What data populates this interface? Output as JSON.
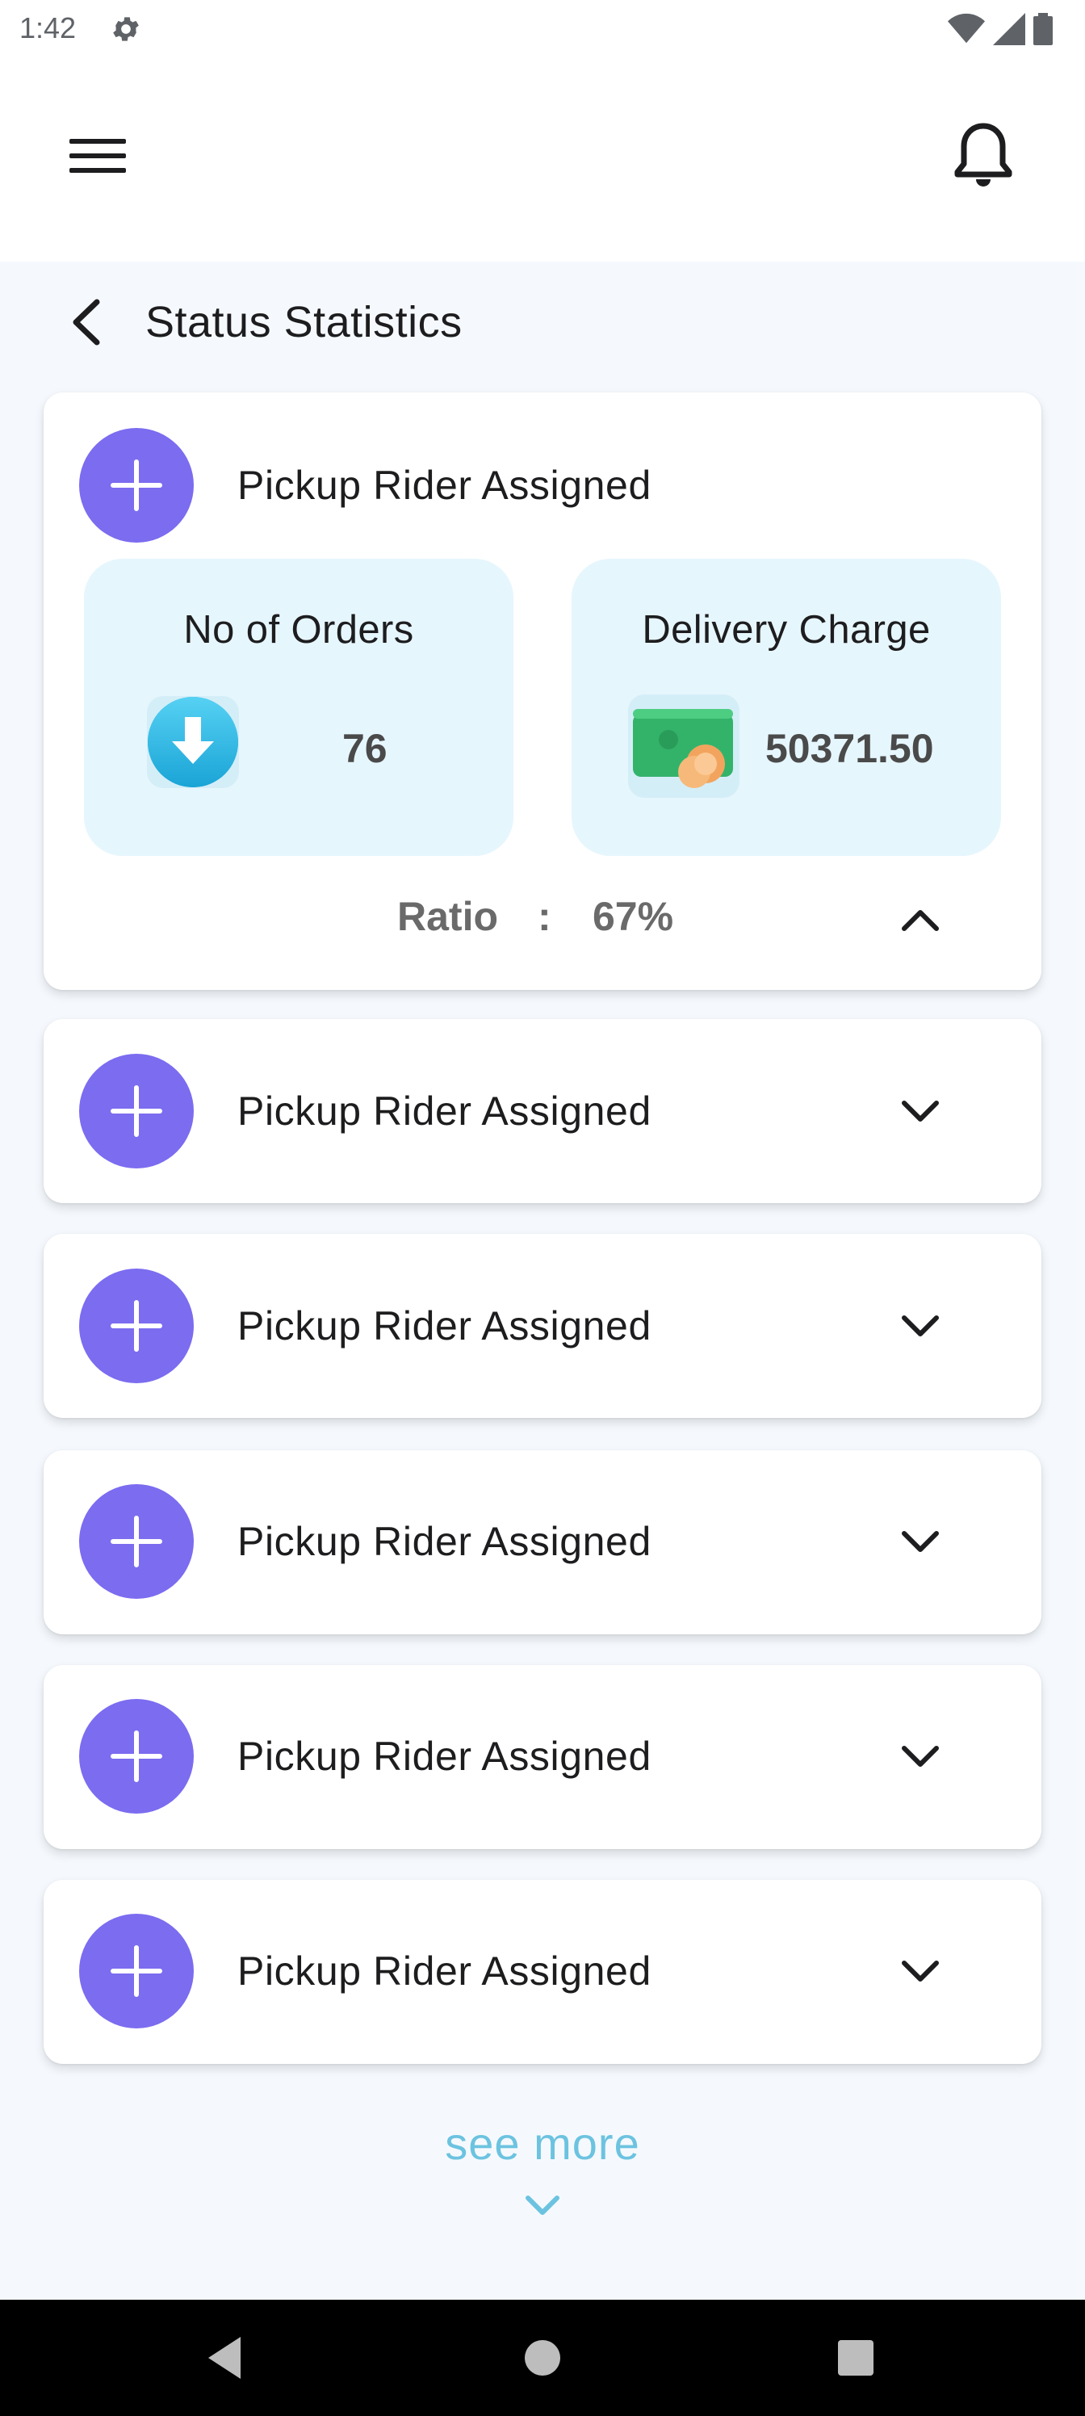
{
  "status_bar": {
    "time": "1:42"
  },
  "page": {
    "title": "Status Statistics"
  },
  "expanded_card": {
    "title": "Pickup Rider Assigned",
    "orders_label": "No of Orders",
    "orders_value": "76",
    "charge_label": "Delivery Charge",
    "charge_value": "50371.50",
    "ratio_label": "Ratio",
    "ratio_sep": ":",
    "ratio_value": "67%"
  },
  "cards": [
    {
      "title": "Pickup Rider Assigned"
    },
    {
      "title": "Pickup Rider Assigned"
    },
    {
      "title": "Pickup Rider Assigned"
    },
    {
      "title": "Pickup Rider Assigned"
    },
    {
      "title": "Pickup Rider Assigned"
    }
  ],
  "see_more": "see more",
  "colors": {
    "accent_purple": "#7b6cf0",
    "stat_bg": "#e6f6fd",
    "link": "#6cc3e0"
  }
}
